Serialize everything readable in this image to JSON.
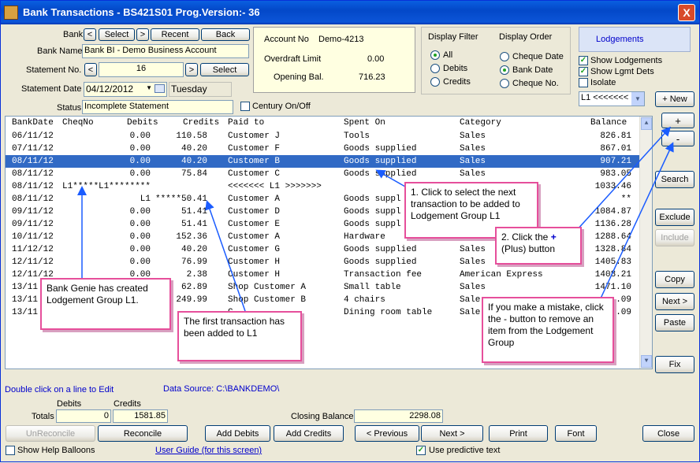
{
  "window": {
    "title": "Bank Transactions - BS421S01   Prog.Version:- 36",
    "close": "X"
  },
  "bank": {
    "label": "Bank",
    "prev": "<",
    "select": "Select",
    "next": ">",
    "recent": "Recent",
    "back": "Back",
    "name_label": "Bank Name",
    "name_value": "Bank BI - Demo Business Account"
  },
  "statement": {
    "no_label": "Statement No.",
    "prev": "<",
    "no_value": "16",
    "next": ">",
    "select": "Select",
    "date_label": "Statement Date",
    "date_value": "04/12/2012",
    "day": "Tuesday",
    "status_label": "Status",
    "status_value": "Incomplete Statement",
    "century_label": "Century On/Off"
  },
  "account": {
    "no_label": "Account No",
    "no_value": "Demo-4213",
    "overdraft_label": "Overdraft Limit",
    "overdraft_value": "0.00",
    "opening_label": "Opening Bal.",
    "opening_value": "716.23"
  },
  "filter": {
    "title": "Display Filter",
    "options": [
      "All",
      "Debits",
      "Credits"
    ],
    "selected": "All"
  },
  "order": {
    "title": "Display Order",
    "options": [
      "Cheque Date",
      "Bank Date",
      "Cheque No."
    ],
    "selected": "Bank Date"
  },
  "lodgements": {
    "label": "Lodgements",
    "show_lodgements": "Show Lodgements",
    "show_lgmt_dets": "Show Lgmt Dets",
    "isolate": "Isolate",
    "group_select": "L1 <<<<<<<"
  },
  "grid": {
    "headers": [
      "BankDate",
      "CheqNo",
      "Debits",
      "Credits",
      "Paid to",
      "Spent On",
      "Category",
      "Balance"
    ],
    "rows": [
      [
        "06/11/12",
        "",
        "0.00",
        "110.58",
        "Customer J",
        "Tools",
        "Sales",
        "826.81"
      ],
      [
        "07/11/12",
        "",
        "0.00",
        "40.20",
        "Customer F",
        "Goods supplied",
        "Sales",
        "867.01"
      ],
      [
        "08/11/12",
        "",
        "0.00",
        "40.20",
        "Customer B",
        "Goods supplied",
        "Sales",
        "907.21"
      ],
      [
        "08/11/12",
        "",
        "0.00",
        "75.84",
        "Customer C",
        "Goods supplied",
        "Sales",
        "983.05"
      ],
      [
        "08/11/12",
        "L1*****",
        "L1********",
        "",
        "<<<<<<< L1 >>>>>>>",
        "",
        "",
        "1033.46"
      ],
      [
        "08/11/12",
        "",
        "L1",
        "*****50.41",
        "Customer A",
        "Goods suppl",
        "",
        "**"
      ],
      [
        "09/11/12",
        "",
        "0.00",
        "51.41",
        "Customer D",
        "Goods suppl",
        "",
        "1084.87"
      ],
      [
        "09/11/12",
        "",
        "0.00",
        "51.41",
        "Customer E",
        "Goods suppl",
        "",
        "1136.28"
      ],
      [
        "10/11/12",
        "",
        "0.00",
        "152.36",
        "Customer A",
        "Hardware",
        "",
        "1288.64"
      ],
      [
        "11/12/12",
        "",
        "0.00",
        "40.20",
        "Customer G",
        "Goods supplied",
        "Sales",
        "1328.84"
      ],
      [
        "12/11/12",
        "",
        "0.00",
        "76.99",
        "Customer H",
        "Goods supplied",
        "Sales",
        "1405.83"
      ],
      [
        "12/11/12",
        "",
        "0.00",
        "2.38",
        "Customer H",
        "Transaction fee",
        "American Express",
        "1408.21"
      ],
      [
        "13/11",
        "",
        "",
        "62.89",
        "Shop Customer A",
        "Small table",
        "Sales",
        "1471.10"
      ],
      [
        "13/11",
        "",
        "",
        "249.99",
        "Shop Customer B",
        "4 chairs",
        "Sale",
        ".09"
      ],
      [
        "13/11",
        "",
        "",
        "",
        "C",
        "Dining room table",
        "Sale",
        ".09"
      ]
    ],
    "selected_row": 2
  },
  "side_buttons": {
    "new": "+ New",
    "plus": "+",
    "minus": "-",
    "search": "Search",
    "exclude": "Exclude",
    "include": "Include",
    "copy": "Copy",
    "next": "Next >",
    "paste": "Paste",
    "fix": "Fix"
  },
  "callouts": {
    "c1": "1. Click to select the next transaction to be added to Lodgement Group L1",
    "c2_a": "2. Click the",
    "c2_plus": "+",
    "c2_b": "(Plus) button",
    "c3": "If you make a mistake, click the - button to remove an item from the Lodgement Group",
    "c4": "Bank Genie has created Lodgement Group L1.",
    "c5": "The first transaction has been added to L1"
  },
  "footer": {
    "dblclick": "Double click on a line to Edit",
    "datasource": "Data Source: C:\\BANKDEMO\\",
    "debits_label": "Debits",
    "credits_label": "Credits",
    "totals_label": "Totals",
    "debits_value": "0",
    "credits_value": "1581.85",
    "closing_label": "Closing Balance",
    "closing_value": "2298.08",
    "unreconcile": "UnReconcile",
    "reconcile": "Reconcile",
    "add_debits": "Add Debits",
    "add_credits": "Add Credits",
    "previous": "< Previous",
    "next": "Next >",
    "print": "Print",
    "font": "Font",
    "close": "Close",
    "help_balloons": "Show Help Balloons",
    "user_guide": "User Guide (for this screen)",
    "predictive": "Use predictive text"
  },
  "colors": {
    "title_bar": "#0348c8",
    "selection": "#316ac5",
    "callout_border": "#e64f9b",
    "arrow": "#1a5cff"
  }
}
